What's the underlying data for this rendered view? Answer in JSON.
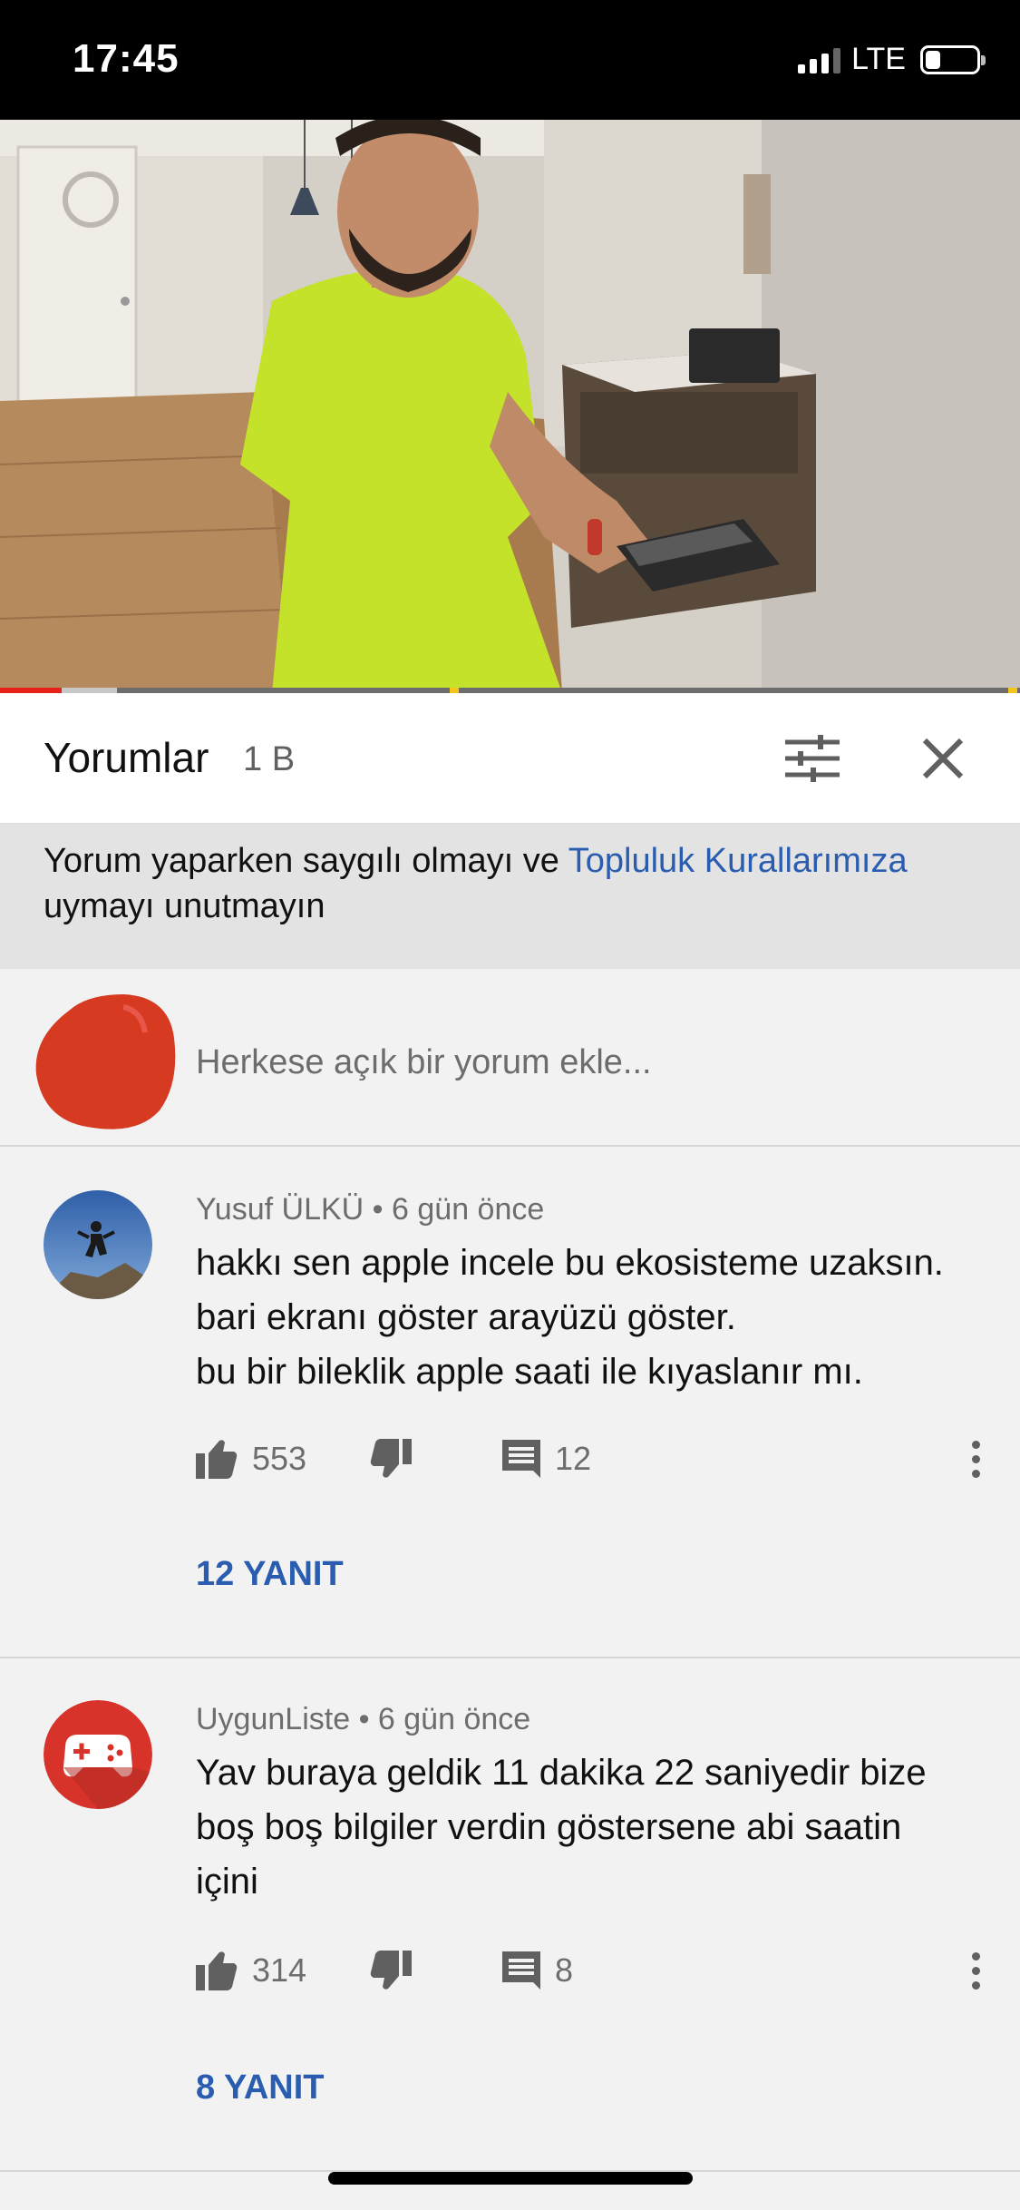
{
  "status_bar": {
    "time": "17:45",
    "network": "LTE",
    "signal_bars": 3,
    "signal_max": 4,
    "battery_level": 0.3
  },
  "video": {
    "progress_fraction": 0.06,
    "buffered_fraction": 0.115,
    "colors": {
      "played": "#e62117",
      "ad_marker": "#f5c518"
    }
  },
  "comments_header": {
    "title": "Yorumlar",
    "count": "1 B",
    "filter_icon": "sort-filter-icon",
    "close_icon": "close-icon"
  },
  "notice": {
    "text_before": "Yorum yaparken saygılı olmayı ve ",
    "link_text": "Topluluk Kurallarımıza",
    "text_after": " uymayı unutmayın",
    "link_color": "#2a5db0"
  },
  "add_comment": {
    "placeholder": "Herkese açık bir yorum ekle..."
  },
  "comments": [
    {
      "author": "Yusuf ÜLKÜ",
      "time": "6 gün önce",
      "text_lines": [
        "hakkı sen apple incele bu ekosisteme uzaksın.",
        "bari ekranı göster arayüzü göster.",
        "bu bir bileklik apple saati ile kıyaslanır mı."
      ],
      "likes": "553",
      "reply_count": "12",
      "replies_label": "12 YANIT"
    },
    {
      "author": "UygunListe",
      "time": "6 gün önce",
      "text_lines": [
        "Yav buraya geldik 11 dakika 22 saniyedir bize",
        "boş boş bilgiler verdin göstersene abi saatin",
        "içini"
      ],
      "likes": "314",
      "reply_count": "8",
      "replies_label": "8 YANIT"
    }
  ],
  "meta_separator": "•"
}
